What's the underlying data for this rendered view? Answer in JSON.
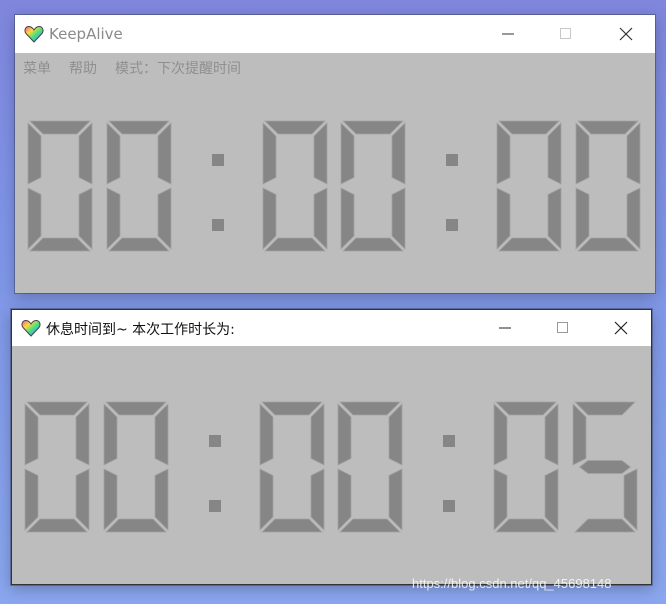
{
  "colors": {
    "segment": "#868686",
    "segment_face": "#8c8c8c",
    "segment_edge": "#a2a2a2",
    "face": "#bdbdbd"
  },
  "window1": {
    "title": "KeepAlive",
    "menu": {
      "item1": "菜单",
      "item2": "帮助",
      "item3": "模式：下次提醒时间"
    },
    "time": "00:00:00",
    "icons": {
      "app": "heart-icon",
      "minimize": "minimize-icon",
      "maximize": "maximize-icon",
      "close": "close-icon"
    }
  },
  "window2": {
    "title": "休息时间到~ 本次工作时长为:",
    "time": "00:00:05",
    "icons": {
      "app": "heart-icon",
      "minimize": "minimize-icon",
      "maximize": "maximize-icon",
      "close": "close-icon"
    }
  },
  "watermark": "https://blog.csdn.net/qq_45698148"
}
